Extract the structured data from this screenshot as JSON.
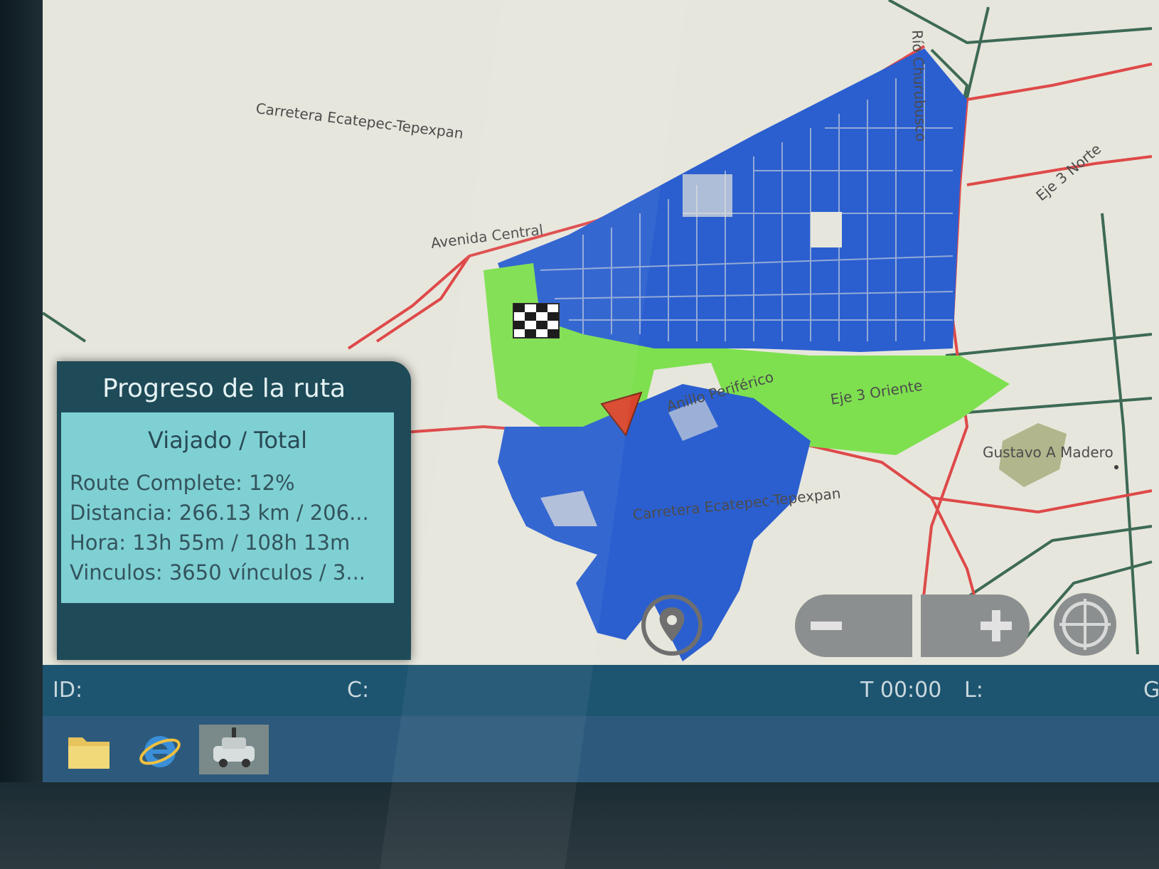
{
  "map": {
    "labels": [
      "Carretera Ecatepec-Tepexpan",
      "Avenida Central",
      "Anillo Periférico",
      "Eje 3 Oriente",
      "Gustavo A Madero",
      "Carretera Ecatepec-Tepexpan",
      "Río Churubusco",
      "Eje 3 Norte"
    ],
    "colors": {
      "completed": "#2b5fcf",
      "pending": "#7ee04f",
      "road_primary": "#de4949",
      "road_secondary": "#3d6a55"
    }
  },
  "progress_panel": {
    "title": "Progreso de la ruta",
    "subtitle": "Viajado / Total",
    "route_complete": "Route Complete: 12%",
    "distance": "Distancia: 266.13 km / 206...",
    "time": "Hora: 13h 55m / 108h 13m",
    "links": "Vinculos: 3650 vínculos / 3...",
    "complete_percent": 12
  },
  "controls": {
    "locate_icon": "location-pin-icon",
    "zoom_out_icon": "minus-icon",
    "zoom_in_icon": "plus-icon",
    "compass_icon": "compass-icon"
  },
  "statusbar": {
    "id_label": "ID:",
    "c_label": "C:",
    "time": "T 00:00",
    "l_label": "L:",
    "g_label": "G"
  },
  "taskbar": {
    "icons": [
      "folder-icon",
      "internet-explorer-icon",
      "vehicle-app-icon"
    ]
  }
}
